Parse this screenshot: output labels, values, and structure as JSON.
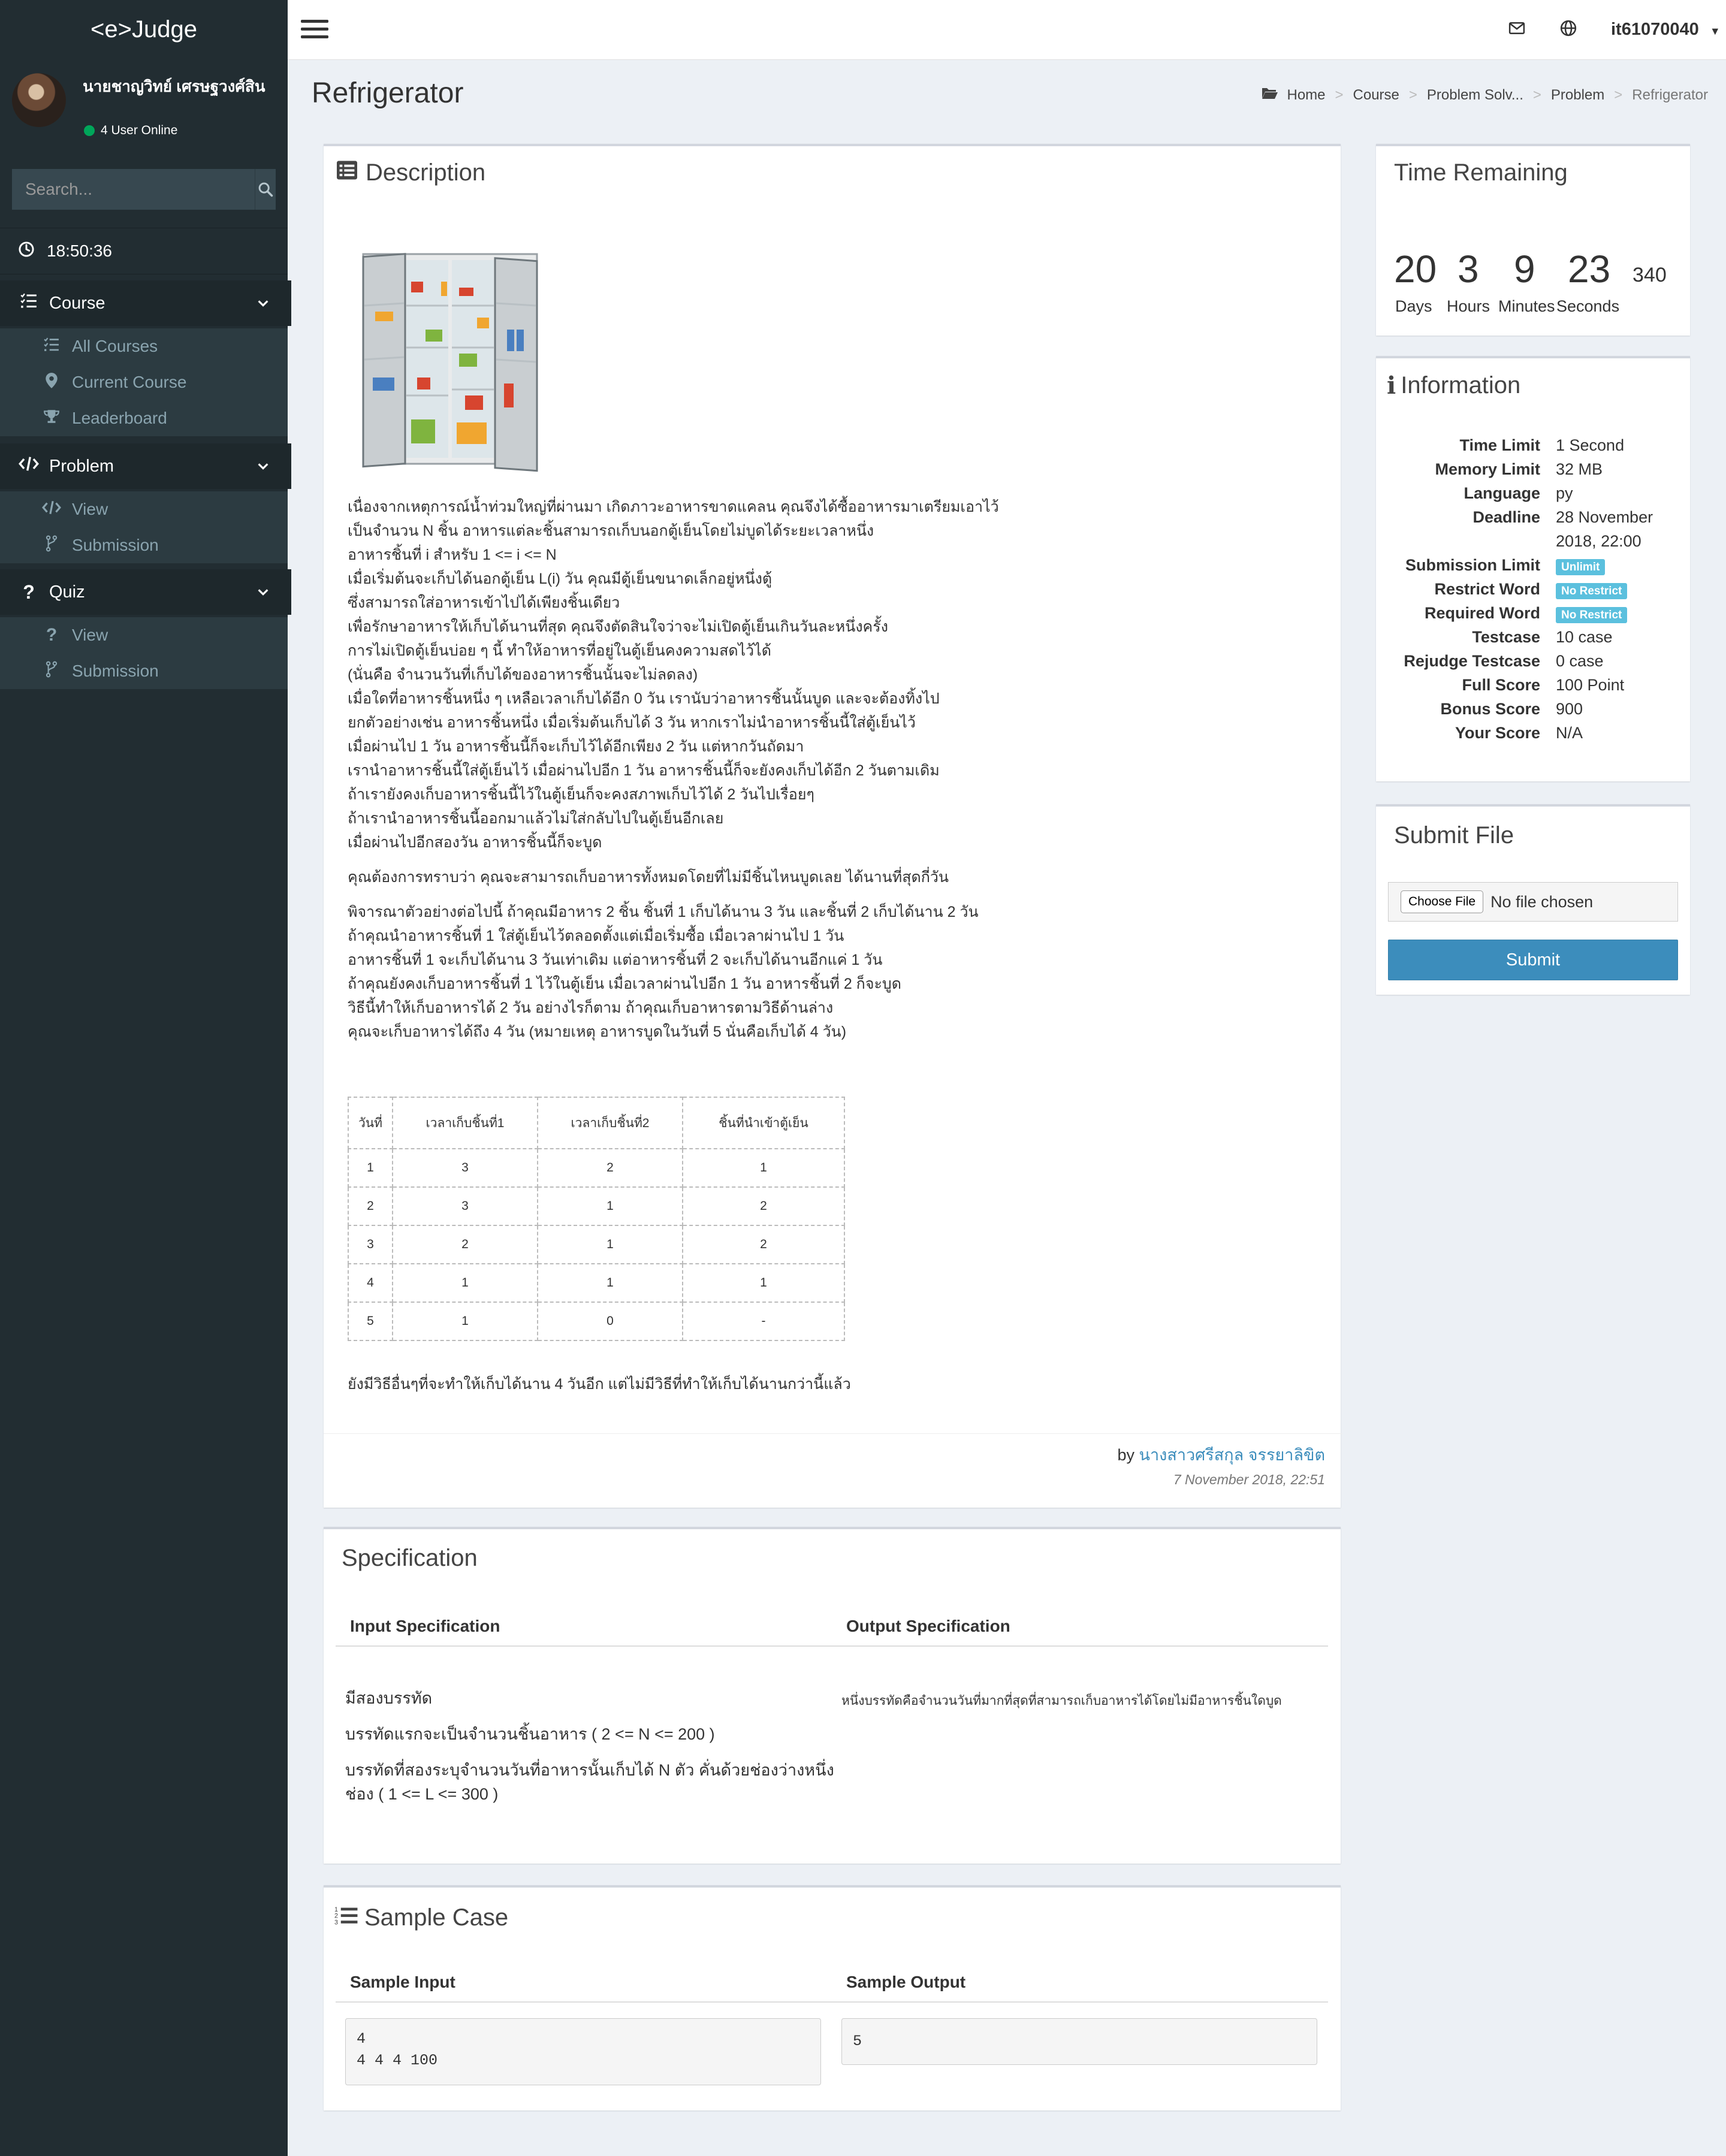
{
  "app": {
    "logo": "<e>Judge"
  },
  "user": {
    "name": "นายชาญวิทย์ เศรษฐวงศ์สิน",
    "online_status": "4 User Online",
    "username": "it61070040"
  },
  "sidebar": {
    "search_placeholder": "Search...",
    "clock": "18:50:36",
    "course": {
      "label": "Course",
      "items": [
        "All Courses",
        "Current Course",
        "Leaderboard"
      ]
    },
    "problem": {
      "label": "Problem",
      "items": [
        "View",
        "Submission"
      ]
    },
    "quiz": {
      "label": "Quiz",
      "items": [
        "View",
        "Submission"
      ]
    }
  },
  "page": {
    "title": "Refrigerator",
    "breadcrumb": [
      "Home",
      "Course",
      "Problem Solv...",
      "Problem",
      "Refrigerator"
    ]
  },
  "description": {
    "title": "Description",
    "lines1": [
      "เนื่องจากเหตุการณ์น้ำท่วมใหญ่ที่ผ่านมา เกิดภาวะอาหารขาดแคลน คุณจึงได้ซื้ออาหารมาเตรียมเอาไว้",
      "เป็นจำนวน N ชิ้น อาหารแต่ละชิ้นสามารถเก็บนอกตู้เย็นโดยไม่บูดได้ระยะเวลาหนึ่ง",
      "อาหารชิ้นที่ i สำหรับ 1 <= i <= N",
      "เมื่อเริ่มต้นจะเก็บได้นอกตู้เย็น L(i) วัน คุณมีตู้เย็นขนาดเล็กอยู่หนึ่งตู้",
      "ซึ่งสามารถใส่อาหารเข้าไปได้เพียงชิ้นเดียว",
      "เพื่อรักษาอาหารให้เก็บได้นานที่สุด คุณจึงตัดสินใจว่าจะไม่เปิดตู้เย็นเกินวันละหนึ่งครั้ง",
      "การไม่เปิดตู้เย็นบ่อย ๆ นี้ ทำให้อาหารที่อยู่ในตู้เย็นคงความสดไว้ได้",
      "(นั่นคือ จำนวนวันที่เก็บได้ของอาหารชิ้นนั้นจะไม่ลดลง)",
      "เมื่อใดที่อาหารชิ้นหนึ่ง ๆ เหลือเวลาเก็บได้อีก 0 วัน เรานับว่าอาหารชิ้นนั้นบูด และจะต้องทิ้งไป",
      "ยกตัวอย่างเช่น อาหารชิ้นหนึ่ง เมื่อเริ่มต้นเก็บได้ 3 วัน หากเราไม่นำอาหารชิ้นนี้ใส่ตู้เย็นไว้",
      "เมื่อผ่านไป 1 วัน อาหารชิ้นนี้ก็จะเก็บไว้ได้อีกเพียง 2 วัน แต่หากวันถัดมา",
      "เรานำอาหารชิ้นนี้ใส่ตู้เย็นไว้ เมื่อผ่านไปอีก 1 วัน อาหารชิ้นนี้ก็จะยังคงเก็บได้อีก 2 วันตามเดิม",
      "ถ้าเรายังคงเก็บอาหารชิ้นนี้ไว้ในตู้เย็นก็จะคงสภาพเก็บไว้ได้ 2 วันไปเรื่อยๆ",
      "ถ้าเรานำอาหารชิ้นนี้ออกมาแล้วไม่ใส่กลับไปในตู้เย็นอีกเลย",
      "เมื่อผ่านไปอีกสองวัน อาหารชิ้นนี้ก็จะบูด"
    ],
    "line2": "คุณต้องการทราบว่า คุณจะสามารถเก็บอาหารทั้งหมดโดยที่ไม่มีชิ้นไหนบูดเลย ได้นานที่สุดกี่วัน",
    "lines3": [
      "พิจารณาตัวอย่างต่อไปนี้ ถ้าคุณมีอาหาร 2 ชิ้น ชิ้นที่ 1 เก็บได้นาน 3 วัน และชิ้นที่ 2 เก็บได้นาน 2 วัน",
      "ถ้าคุณนำอาหารชิ้นที่ 1 ใส่ตู้เย็นไว้ตลอดตั้งแต่เมื่อเริ่มซื้อ เมื่อเวลาผ่านไป 1 วัน",
      "อาหารชิ้นที่ 1 จะเก็บได้นาน 3 วันเท่าเดิม แต่อาหารชิ้นที่ 2 จะเก็บได้นานอีกแค่ 1 วัน",
      "ถ้าคุณยังคงเก็บอาหารชิ้นที่ 1 ไว้ในตู้เย็น เมื่อเวลาผ่านไปอีก 1 วัน อาหารชิ้นที่ 2 ก็จะบูด",
      "วิธีนี้ทำให้เก็บอาหารได้ 2 วัน อย่างไรก็ตาม ถ้าคุณเก็บอาหารตามวิธีด้านล่าง",
      "คุณจะเก็บอาหารได้ถึง 4 วัน (หมายเหตุ อาหารบูดในวันที่ 5 นั่นคือเก็บได้ 4 วัน)"
    ],
    "table": {
      "headers": [
        "วันที่",
        "เวลาเก็บชิ้นที่1",
        "เวลาเก็บชิ้นที่2",
        "ชิ้นที่นำเข้าตู้เย็น"
      ],
      "rows": [
        [
          "1",
          "3",
          "2",
          "1"
        ],
        [
          "2",
          "3",
          "1",
          "2"
        ],
        [
          "3",
          "2",
          "1",
          "2"
        ],
        [
          "4",
          "1",
          "1",
          "1"
        ],
        [
          "5",
          "1",
          "0",
          "-"
        ]
      ]
    },
    "after_table": "ยังมีวิธีอื่นๆที่จะทำให้เก็บได้นาน 4 วันอีก แต่ไม่มีวิธีที่ทำให้เก็บได้นานกว่านี้แล้ว",
    "by_label": "by",
    "author": "นางสาวศรีสกุล จรรยาลิขิต",
    "date": "7 November 2018, 22:51"
  },
  "timer": {
    "title": "Time Remaining",
    "days": "20",
    "hours": "3",
    "minutes": "9",
    "seconds": "23",
    "extra": "340",
    "labels": {
      "days": "Days",
      "hours": "Hours",
      "minutes": "Minutes",
      "seconds": "Seconds"
    }
  },
  "information": {
    "title": "Information",
    "time_limit": {
      "label": "Time Limit",
      "value": "1 Second"
    },
    "memory_limit": {
      "label": "Memory Limit",
      "value": "32 MB"
    },
    "language": {
      "label": "Language",
      "value": "py"
    },
    "deadline": {
      "label": "Deadline",
      "value1": "28 November",
      "value2": "2018, 22:00"
    },
    "submission_limit": {
      "label": "Submission Limit",
      "value": "Unlimit"
    },
    "restrict_word": {
      "label": "Restrict Word",
      "value": "No Restrict"
    },
    "required_word": {
      "label": "Required Word",
      "value": "No Restrict"
    },
    "testcase": {
      "label": "Testcase",
      "value": "10 case"
    },
    "rejudge": {
      "label": "Rejudge Testcase",
      "value": "0 case"
    },
    "full_score": {
      "label": "Full Score",
      "value": "100 Point"
    },
    "bonus_score": {
      "label": "Bonus Score",
      "value": "900"
    },
    "your_score": {
      "label": "Your Score",
      "value": "N/A"
    }
  },
  "submit_file": {
    "title": "Submit File",
    "choose": "Choose File",
    "no_file": "No file chosen",
    "submit": "Submit"
  },
  "specification": {
    "title": "Specification",
    "input_header": "Input Specification",
    "output_header": "Output Specification",
    "input_lines": [
      "มีสองบรรทัด",
      "บรรทัดแรกจะเป็นจำนวนชิ้นอาหาร ( 2 <= N <= 200 )",
      "บรรทัดที่สองระบุจำนวนวันที่อาหารนั้นเก็บได้ N ตัว คั่นด้วยช่องว่างหนึ่ง",
      "ช่อง ( 1 <= L <= 300 )"
    ],
    "output_text": "หนึ่งบรรทัดคือจำนวนวันที่มากที่สุดที่สามารถเก็บอาหารได้โดยไม่มีอาหารชิ้นใดบูด"
  },
  "sample": {
    "title": "Sample Case",
    "input_header": "Sample Input",
    "output_header": "Sample Output",
    "input_line1": "4",
    "input_line2": "4 4 4 100",
    "output": "5"
  }
}
